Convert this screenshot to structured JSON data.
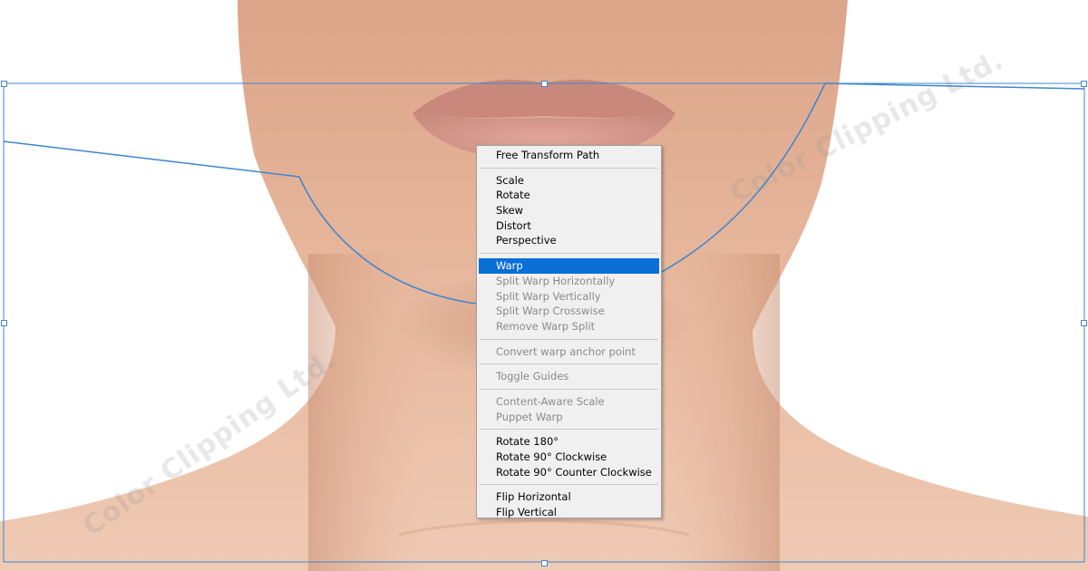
{
  "watermark": "Color Clipping Ltd.",
  "context_menu": {
    "groups": [
      [
        {
          "label": "Free Transform Path",
          "state": "enabled"
        }
      ],
      [
        {
          "label": "Scale",
          "state": "enabled"
        },
        {
          "label": "Rotate",
          "state": "enabled"
        },
        {
          "label": "Skew",
          "state": "enabled"
        },
        {
          "label": "Distort",
          "state": "enabled"
        },
        {
          "label": "Perspective",
          "state": "enabled"
        }
      ],
      [
        {
          "label": "Warp",
          "state": "selected"
        },
        {
          "label": "Split Warp Horizontally",
          "state": "disabled"
        },
        {
          "label": "Split Warp Vertically",
          "state": "disabled"
        },
        {
          "label": "Split Warp Crosswise",
          "state": "disabled"
        },
        {
          "label": "Remove Warp Split",
          "state": "disabled"
        }
      ],
      [
        {
          "label": "Convert warp anchor point",
          "state": "disabled"
        }
      ],
      [
        {
          "label": "Toggle Guides",
          "state": "disabled"
        }
      ],
      [
        {
          "label": "Content-Aware Scale",
          "state": "disabled"
        },
        {
          "label": "Puppet Warp",
          "state": "disabled"
        }
      ],
      [
        {
          "label": "Rotate 180°",
          "state": "enabled"
        },
        {
          "label": "Rotate 90° Clockwise",
          "state": "enabled"
        },
        {
          "label": "Rotate 90° Counter Clockwise",
          "state": "enabled"
        }
      ],
      [
        {
          "label": "Flip Horizontal",
          "state": "enabled"
        },
        {
          "label": "Flip Vertical",
          "state": "enabled"
        }
      ]
    ]
  },
  "colors": {
    "selection": "#0a6fd6",
    "transform_line": "#3d86d0",
    "menu_bg": "#f0f0f0",
    "skin": "#e8b99d"
  }
}
